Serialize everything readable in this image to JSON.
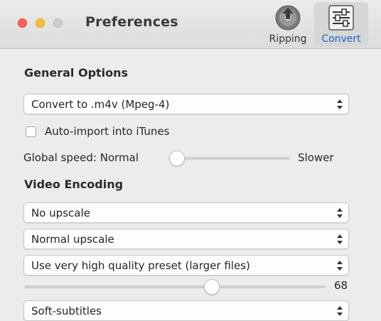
{
  "window": {
    "title": "Preferences"
  },
  "toolbar": {
    "ripping_label": "Ripping",
    "convert_label": "Convert",
    "selected": "Convert",
    "accent": "#1f64c9"
  },
  "general": {
    "title": "General Options",
    "format_popup": "Convert to .m4v (Mpeg-4)",
    "auto_import_label": "Auto-import into iTunes",
    "auto_import_checked": false,
    "speed_label": "Global speed: Normal",
    "speed_max_label": "Slower",
    "speed_value": 0
  },
  "video": {
    "title": "Video Encoding",
    "upscale_popup": "No upscale",
    "upscale_mode_popup": "Normal upscale",
    "quality_popup": "Use very high quality preset (larger files)",
    "quality_value": "68",
    "quality_fraction": 0.63,
    "subtitles_popup": "Soft-subtitles"
  }
}
